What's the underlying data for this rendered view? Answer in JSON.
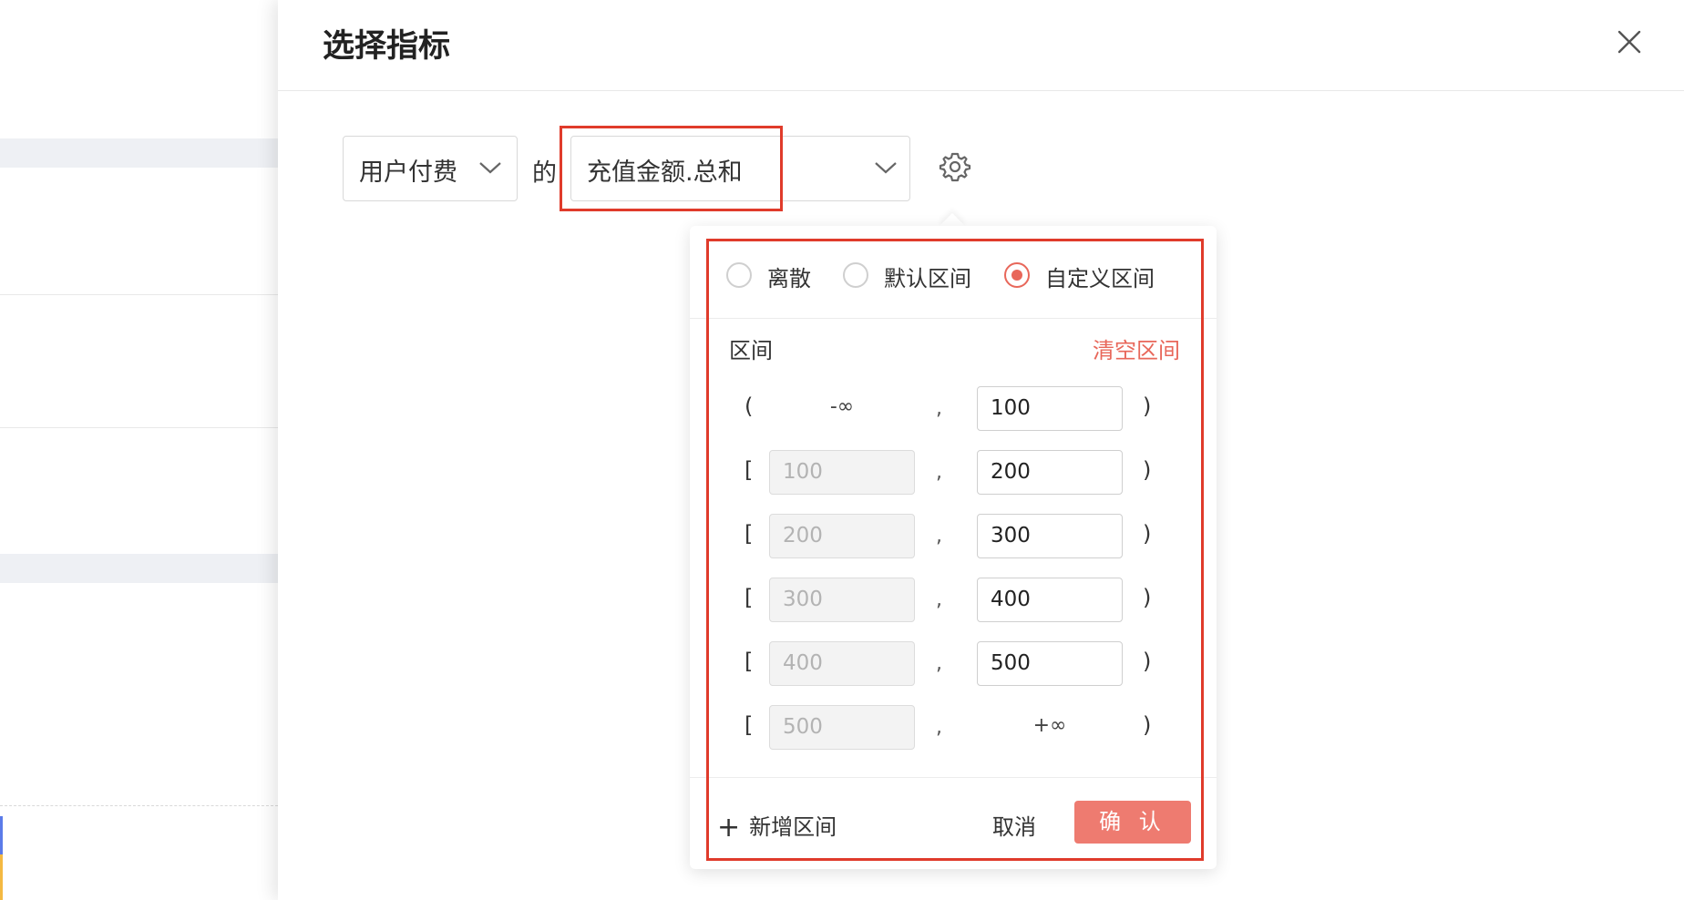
{
  "drawer": {
    "title": "选择指标"
  },
  "metric_select": {
    "event": "用户付费",
    "connector": "的",
    "field": "充值金额.总和"
  },
  "bucket_popover": {
    "modes": [
      {
        "label": "离散",
        "checked": false
      },
      {
        "label": "默认区间",
        "checked": false
      },
      {
        "label": "自定义区间",
        "checked": true
      }
    ],
    "section_label": "区间",
    "clear_label": "清空区间",
    "rows": [
      {
        "open": "(",
        "start": "-∞",
        "start_editable": false,
        "end": "100",
        "close": ")"
      },
      {
        "open": "[",
        "start": "100",
        "start_editable": true,
        "end": "200",
        "close": ")"
      },
      {
        "open": "[",
        "start": "200",
        "start_editable": true,
        "end": "300",
        "close": ")"
      },
      {
        "open": "[",
        "start": "300",
        "start_editable": true,
        "end": "400",
        "close": ")"
      },
      {
        "open": "[",
        "start": "400",
        "start_editable": true,
        "end": "500",
        "close": ")"
      },
      {
        "open": "[",
        "start": "500",
        "start_editable": true,
        "end": "+∞",
        "close": ")"
      }
    ],
    "separator": ",",
    "add_label": "新增区间",
    "cancel_label": "取消",
    "confirm_label": "确 认"
  },
  "colors": {
    "accent": "#e8675a",
    "confirm_bg": "#ee7b70",
    "highlight": "#e03b2b"
  }
}
